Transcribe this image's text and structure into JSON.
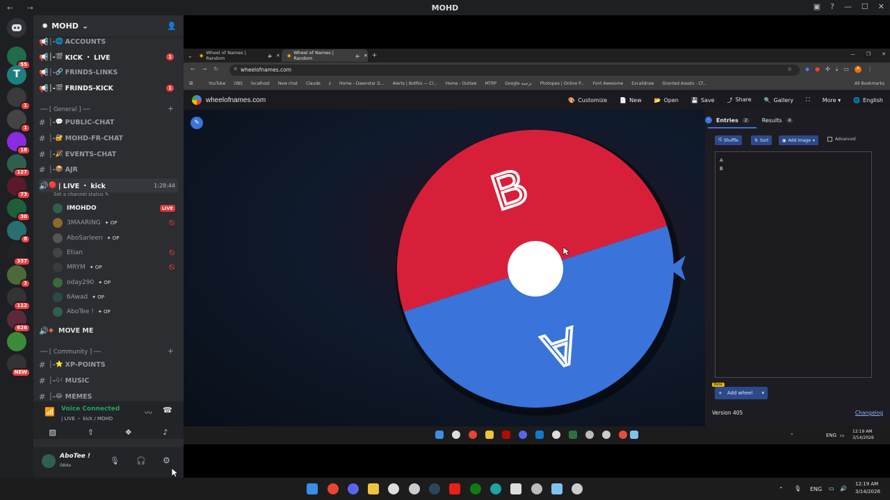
{
  "window": {
    "title": "MOHD",
    "nav": "←  →"
  },
  "rail": {
    "servers": [
      {
        "badge": "55",
        "color": "#1f6b4a"
      },
      {
        "badge": "",
        "color": "#1f7f7f",
        "letter": "T"
      },
      {
        "badge": "1",
        "color": "#3a3a3a"
      },
      {
        "badge": "1",
        "color": "#444"
      },
      {
        "badge": "18",
        "color": "#8a2be2"
      },
      {
        "badge": "127",
        "color": "#2f5f4f"
      },
      {
        "badge": "73",
        "color": "#5a1a2a"
      },
      {
        "badge": "30",
        "color": "#1e5f3a"
      },
      {
        "badge": "8",
        "color": "#2a6f6f"
      },
      {
        "badge": "337",
        "color": "#222"
      },
      {
        "badge": "3",
        "color": "#4a6a3a"
      },
      {
        "badge": "112",
        "color": "#333"
      },
      {
        "badge": "626",
        "color": "#5a2a3a"
      },
      {
        "badge": "",
        "color": "#3a8a3a"
      },
      {
        "badge": "NEW",
        "color": "#333"
      }
    ]
  },
  "server": {
    "name": "MOHD",
    "chevron": "⌄"
  },
  "channels": {
    "top": [
      {
        "name": "ACCOUNTS",
        "prefix": "│-",
        "emoji": "🌐",
        "badge": ""
      },
      {
        "name": "KICK ・ LIVE",
        "prefix": "│-",
        "emoji": "🎬",
        "badge": "1"
      },
      {
        "name": "FRINDS-LINKS",
        "prefix": "│-",
        "emoji": "🔗",
        "badge": ""
      },
      {
        "name": "FRINDS-KICK",
        "prefix": "│-",
        "emoji": "🎬",
        "badge": "1"
      }
    ],
    "general_category": "── [ General ] ──",
    "general": [
      {
        "name": "PUBLIC-CHAT",
        "prefix": "│-",
        "emoji": "💬"
      },
      {
        "name": "MOHD-FR-CHAT",
        "prefix": "│-",
        "emoji": "🔐"
      },
      {
        "name": "EVENTS-CHAT",
        "prefix": "│-",
        "emoji": "🎉"
      },
      {
        "name": "AJR",
        "prefix": "│-",
        "emoji": "📦"
      }
    ],
    "voice_channel": {
      "name": "| LIVE ・ kick",
      "timer": "1:28:44",
      "status": "Set a channel status"
    },
    "voice_users": [
      {
        "name": "IMOHDO",
        "live": "LIVE",
        "op": "",
        "muted": false
      },
      {
        "name": "3MAARING",
        "live": "",
        "op": "OP",
        "muted": true
      },
      {
        "name": "AboSarleen",
        "live": "",
        "op": "OP",
        "muted": false
      },
      {
        "name": "Etian",
        "live": "",
        "op": "",
        "muted": true
      },
      {
        "name": "MRYM",
        "live": "",
        "op": "OP",
        "muted": true
      },
      {
        "name": "oday290",
        "live": "",
        "op": "OP",
        "muted": false
      },
      {
        "name": "6Awad",
        "live": "",
        "op": "OP",
        "muted": false
      },
      {
        "name": "AboTee !",
        "live": "",
        "op": "OP",
        "muted": false
      }
    ],
    "move_me": "MOVE ME",
    "community_category": "── [ Community ] ──",
    "community": [
      {
        "name": "XP-POINTS",
        "prefix": "│-",
        "emoji": "⭐"
      },
      {
        "name": "MUSIC",
        "prefix": "│-",
        "emoji": "🎶"
      },
      {
        "name": "MEMES",
        "prefix": "│-",
        "emoji": "😂"
      }
    ]
  },
  "voice_panel": {
    "status": "Voice Connected",
    "channel": "| LIVE ・ kick / MOHD"
  },
  "user_panel": {
    "name": "AboTee !",
    "tag": "084x"
  },
  "browser": {
    "tabs": [
      {
        "title": "Wheel of Names | Random"
      },
      {
        "title": "Wheel of Names | Random"
      }
    ],
    "url": "wheelofnames.com",
    "bookmarks": [
      "YouTube",
      "OBS",
      "localhost",
      "New chat",
      "Claude",
      "z",
      "Home - Dawnstar D...",
      "Alerts | BotRix — Cl...",
      "Home - Outlaw",
      "MTRP",
      "Google ترجمة",
      "Photopea | Online P...",
      "Font Awesome",
      "Excalidraw",
      "Granted Assets - Cf...",
      "All Bookmarks"
    ]
  },
  "site": {
    "name": "wheelofnames.com",
    "nav": [
      "Customize",
      "New",
      "Open",
      "Save",
      "Share",
      "Gallery",
      "More",
      "English"
    ],
    "tabs": {
      "entries": "Entries",
      "entries_count": "2",
      "results": "Results",
      "results_count": "4"
    },
    "buttons": {
      "shuffle": "Shuffle",
      "sort": "Sort",
      "add_image": "Add image",
      "advanced": "Advanced",
      "add_wheel": "Add wheel",
      "beta": "Beta"
    },
    "entries": [
      "A",
      "B"
    ],
    "version": "Version 405",
    "changelog": "Changelog",
    "wheel": {
      "segments": [
        {
          "label": "B",
          "color": "#d81f3a"
        },
        {
          "label": "A",
          "color": "#3a73d9"
        }
      ]
    }
  },
  "inner_clock": {
    "time": "12:19 AM",
    "date": "3/14/2026",
    "lang": "ENG"
  },
  "taskbar": {
    "time": "12:19 AM",
    "date": "3/14/2026",
    "lang": "ENG"
  }
}
